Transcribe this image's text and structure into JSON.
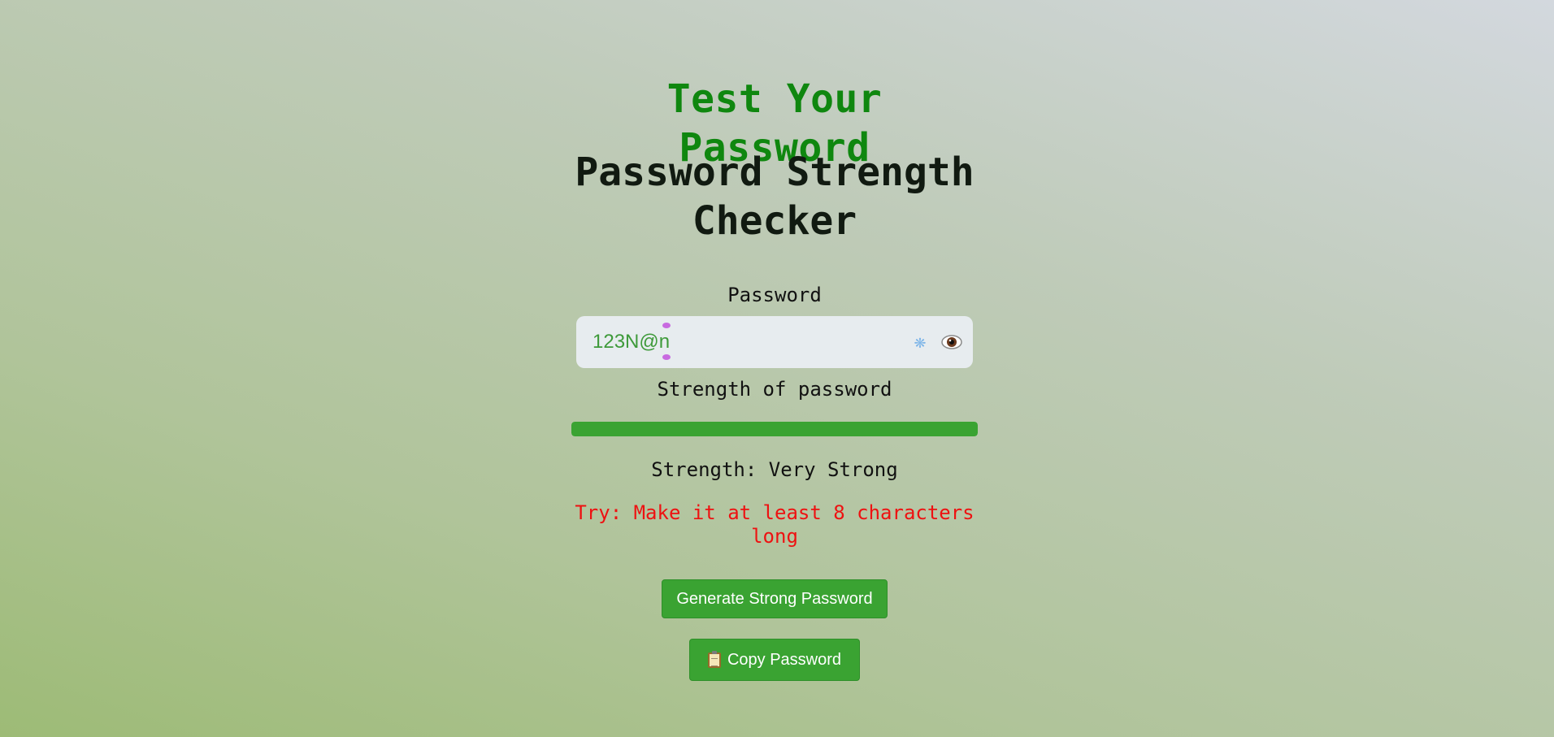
{
  "header": {
    "title": "Test Your Password",
    "subtitle_line1": "Password Strength",
    "subtitle_line2": "Checker"
  },
  "password_field": {
    "label": "Password",
    "value": "123N@n",
    "icons": [
      "sparkle-icon",
      "eye-icon"
    ]
  },
  "strength": {
    "label": "Strength of password",
    "bar_fill_percent": 100,
    "text_prefix": "Strength:",
    "value": "Very Strong",
    "tip_line1": "Try: Make it at least 8 characters",
    "tip_line2": "long"
  },
  "buttons": {
    "generate": "Generate Strong Password",
    "copy": "Copy Password"
  },
  "colors": {
    "title": "#0f870f",
    "accent": "#3aa332",
    "tip": "#ee1111",
    "input_text": "#3e9a3a"
  }
}
